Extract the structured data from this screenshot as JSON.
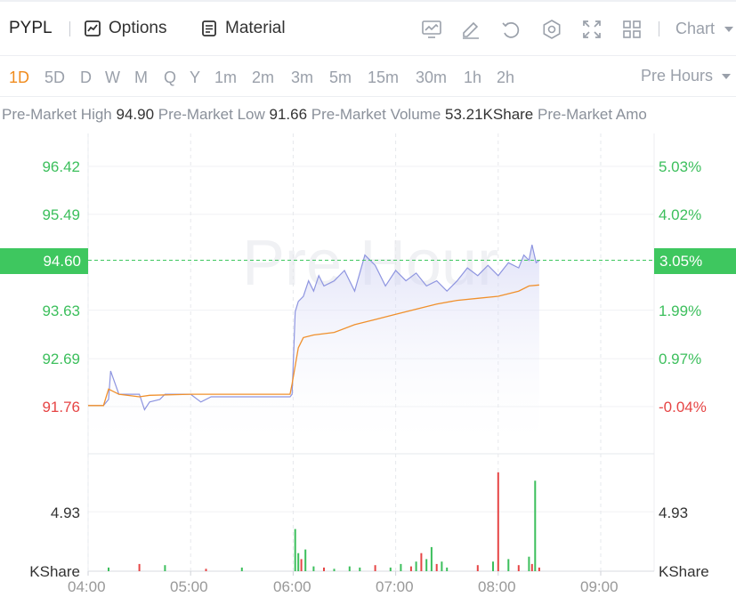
{
  "header": {
    "ticker": "PYPL",
    "options_label": "Options",
    "material_label": "Material",
    "chart_selector": "Chart",
    "icons": [
      "indicator-icon",
      "draw-icon",
      "reset-icon",
      "settings-icon",
      "fullscreen-icon",
      "layout-icon"
    ]
  },
  "periods": {
    "items": [
      "1D",
      "5D",
      "D",
      "W",
      "M",
      "Q",
      "Y",
      "1m",
      "2m",
      "3m",
      "5m",
      "15m",
      "30m",
      "1h",
      "2h"
    ],
    "active": "1D",
    "session_selector": "Pre Hours"
  },
  "stats": {
    "high_label": "Pre-Market High",
    "high_value": "94.90",
    "low_label": "Pre-Market Low",
    "low_value": "91.66",
    "volume_label": "Pre-Market Volume",
    "volume_value": "53.21KShare",
    "amount_label": "Pre-Market Amo"
  },
  "colors": {
    "up": "#3cbf5c",
    "down": "#e64545",
    "accent": "#f08c1e",
    "price_line": "#8e95e0",
    "avg_line": "#f0902c"
  },
  "chart_data": {
    "type": "line",
    "watermark": "Pre Hour",
    "price_axis": {
      "ticks": [
        "96.42",
        "95.49",
        "93.63",
        "92.69",
        "91.76"
      ],
      "current": "94.60",
      "ylim": [
        91.2,
        97.2
      ]
    },
    "percent_axis": {
      "ticks": [
        "5.03%",
        "4.02%",
        "1.99%",
        "0.97%",
        "-0.04%"
      ],
      "current": "3.05%"
    },
    "volume_axis": {
      "tick": "4.93",
      "unit": "KShare",
      "unit_right": "KShare"
    },
    "x_ticks": [
      "04:00",
      "05:00",
      "06:00",
      "07:00",
      "08:00",
      "09:00"
    ],
    "xlim_hours": [
      4.0,
      9.0
    ],
    "series": [
      {
        "key": "price",
        "x": [
          4.0,
          4.15,
          4.2,
          4.22,
          4.3,
          4.5,
          4.55,
          4.6,
          4.7,
          4.75,
          5.0,
          5.1,
          5.2,
          5.5,
          5.9,
          5.97,
          5.99,
          6.02,
          6.05,
          6.1,
          6.15,
          6.2,
          6.25,
          6.3,
          6.4,
          6.5,
          6.6,
          6.7,
          6.8,
          6.9,
          7.0,
          7.1,
          7.2,
          7.3,
          7.4,
          7.5,
          7.6,
          7.7,
          7.8,
          7.9,
          8.0,
          8.1,
          8.2,
          8.25,
          8.3,
          8.33,
          8.37,
          8.4
        ],
        "y": [
          91.78,
          91.78,
          91.9,
          92.45,
          92.0,
          92.0,
          91.7,
          91.85,
          91.9,
          92.0,
          92.0,
          91.85,
          91.95,
          91.95,
          91.95,
          91.95,
          92.0,
          93.6,
          93.8,
          93.9,
          94.2,
          94.0,
          94.3,
          94.1,
          94.2,
          94.4,
          94.0,
          94.7,
          94.5,
          94.1,
          94.4,
          94.2,
          94.35,
          94.1,
          94.2,
          94.0,
          94.2,
          94.45,
          94.3,
          94.5,
          94.3,
          94.55,
          94.45,
          94.7,
          94.6,
          94.9,
          94.55,
          94.6
        ]
      },
      {
        "key": "average",
        "x": [
          4.0,
          4.15,
          4.2,
          4.3,
          4.5,
          4.6,
          5.0,
          5.5,
          5.9,
          5.97,
          5.99,
          6.05,
          6.1,
          6.2,
          6.4,
          6.6,
          6.8,
          7.0,
          7.2,
          7.4,
          7.6,
          7.8,
          8.0,
          8.2,
          8.3,
          8.4
        ],
        "y": [
          91.78,
          91.78,
          92.1,
          92.0,
          91.95,
          91.98,
          92.0,
          92.0,
          92.0,
          92.0,
          92.2,
          92.9,
          93.1,
          93.15,
          93.2,
          93.35,
          93.45,
          93.55,
          93.65,
          93.75,
          93.82,
          93.86,
          93.9,
          94.0,
          94.1,
          94.12
        ]
      }
    ],
    "volume": {
      "x": [
        4.2,
        4.5,
        4.75,
        5.15,
        5.5,
        6.02,
        6.05,
        6.08,
        6.12,
        6.2,
        6.3,
        6.4,
        6.55,
        6.65,
        6.8,
        6.95,
        7.05,
        7.15,
        7.2,
        7.25,
        7.3,
        7.35,
        7.4,
        7.45,
        7.5,
        7.8,
        7.95,
        8.0,
        8.1,
        8.2,
        8.3,
        8.33,
        8.36,
        8.4
      ],
      "v": [
        0.3,
        0.6,
        0.5,
        0.2,
        0.3,
        3.5,
        1.5,
        1.0,
        1.8,
        0.4,
        0.3,
        0.2,
        0.4,
        0.3,
        0.5,
        0.3,
        0.6,
        0.4,
        0.8,
        1.5,
        1.0,
        2.0,
        0.6,
        0.8,
        0.3,
        0.5,
        0.8,
        8.2,
        1.0,
        0.5,
        1.2,
        0.6,
        7.5,
        0.3
      ],
      "up": [
        true,
        false,
        true,
        false,
        true,
        true,
        true,
        false,
        true,
        true,
        false,
        true,
        true,
        true,
        false,
        true,
        true,
        false,
        true,
        false,
        true,
        true,
        false,
        true,
        true,
        false,
        true,
        false,
        true,
        false,
        true,
        false,
        true,
        false
      ],
      "vmax": 9.0
    }
  }
}
